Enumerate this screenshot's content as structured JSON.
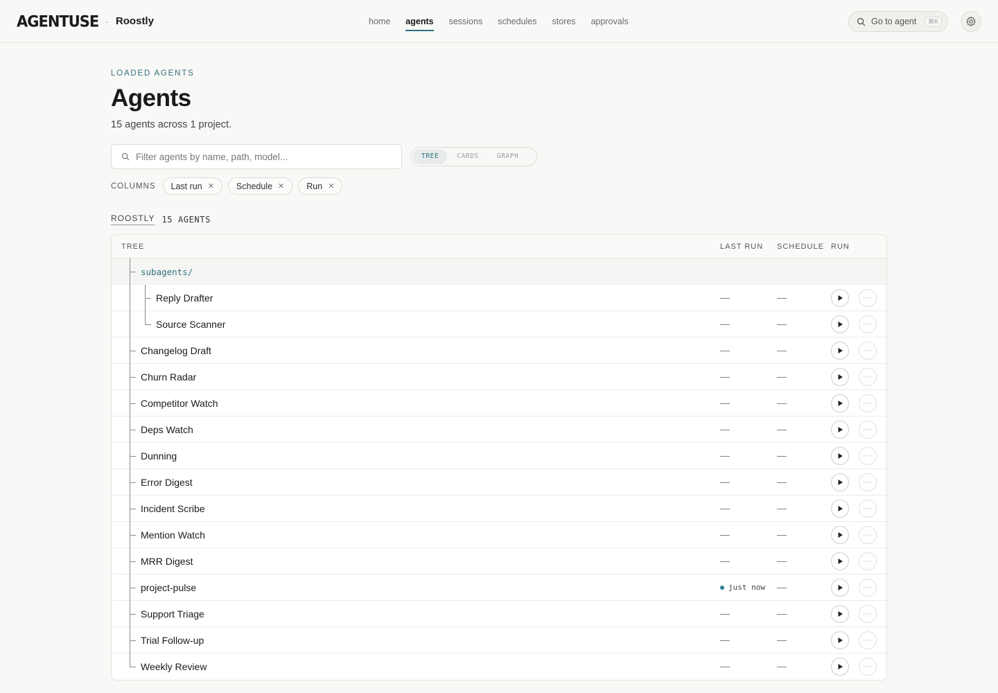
{
  "header": {
    "logo_text": "AGENTUSE",
    "separator": "·",
    "project": "Roostly",
    "nav": [
      "home",
      "agents",
      "sessions",
      "schedules",
      "stores",
      "approvals"
    ],
    "active_nav": "agents",
    "goto_label": "Go to agent",
    "goto_shortcut": "⌘K"
  },
  "page": {
    "eyebrow": "LOADED AGENTS",
    "title": "Agents",
    "subtitle": "15 agents across 1 project.",
    "filter_placeholder": "Filter agents by name, path, model...",
    "view_modes": [
      "TREE",
      "CARDS",
      "GRAPH"
    ],
    "active_view": "TREE",
    "columns_label": "COLUMNS",
    "columns": [
      "Last run",
      "Schedule",
      "Run"
    ],
    "group_name": "ROOSTLY",
    "group_count": "15 AGENTS"
  },
  "table": {
    "headers": {
      "tree": "TREE",
      "last_run": "LAST RUN",
      "schedule": "SCHEDULE",
      "run": "RUN"
    },
    "empty_value": "—",
    "rows": [
      {
        "name": "subagents/",
        "kind": "folder",
        "depth": 0,
        "last_run": "",
        "schedule": ""
      },
      {
        "name": "Reply Drafter",
        "kind": "agent",
        "depth": 1,
        "last_run": "—",
        "schedule": "—"
      },
      {
        "name": "Source Scanner",
        "kind": "agent",
        "depth": 1,
        "last_run": "—",
        "schedule": "—"
      },
      {
        "name": "Changelog Draft",
        "kind": "agent",
        "depth": 0,
        "last_run": "—",
        "schedule": "—"
      },
      {
        "name": "Churn Radar",
        "kind": "agent",
        "depth": 0,
        "last_run": "—",
        "schedule": "—"
      },
      {
        "name": "Competitor Watch",
        "kind": "agent",
        "depth": 0,
        "last_run": "—",
        "schedule": "—"
      },
      {
        "name": "Deps Watch",
        "kind": "agent",
        "depth": 0,
        "last_run": "—",
        "schedule": "—"
      },
      {
        "name": "Dunning",
        "kind": "agent",
        "depth": 0,
        "last_run": "—",
        "schedule": "—"
      },
      {
        "name": "Error Digest",
        "kind": "agent",
        "depth": 0,
        "last_run": "—",
        "schedule": "—"
      },
      {
        "name": "Incident Scribe",
        "kind": "agent",
        "depth": 0,
        "last_run": "—",
        "schedule": "—"
      },
      {
        "name": "Mention Watch",
        "kind": "agent",
        "depth": 0,
        "last_run": "—",
        "schedule": "—"
      },
      {
        "name": "MRR Digest",
        "kind": "agent",
        "depth": 0,
        "last_run": "—",
        "schedule": "—"
      },
      {
        "name": "project-pulse",
        "kind": "agent",
        "depth": 0,
        "last_run": "just now",
        "last_run_status": "active",
        "schedule": "—"
      },
      {
        "name": "Support Triage",
        "kind": "agent",
        "depth": 0,
        "last_run": "—",
        "schedule": "—"
      },
      {
        "name": "Trial Follow-up",
        "kind": "agent",
        "depth": 0,
        "last_run": "—",
        "schedule": "—"
      },
      {
        "name": "Weekly Review",
        "kind": "agent",
        "depth": 0,
        "last_run": "—",
        "schedule": "—"
      }
    ]
  },
  "colors": {
    "accent": "#2f6f7e",
    "status_dot": "#2f7d95",
    "background": "#f8f8f6"
  },
  "icons": {
    "search": "search-icon",
    "settings": "gear-icon",
    "run": "play-icon",
    "more": "more-icon",
    "remove": "close-icon"
  }
}
